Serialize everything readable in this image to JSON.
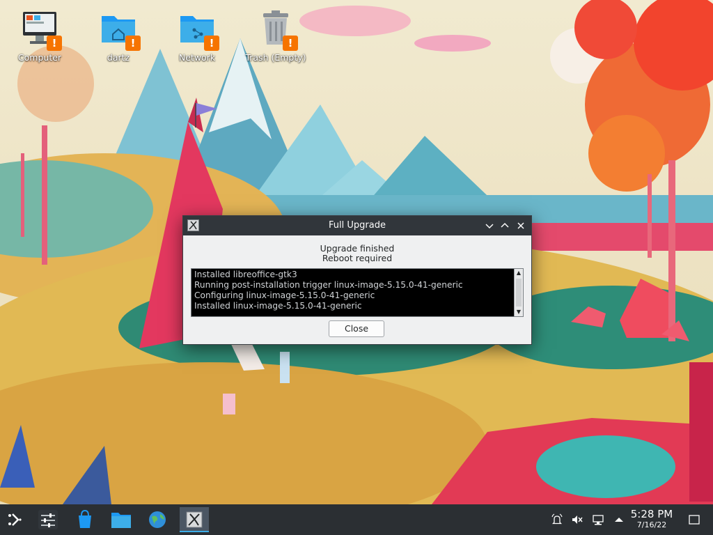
{
  "desktop": {
    "icons": [
      {
        "label": "Computer",
        "icon": "computer-icon"
      },
      {
        "label": "dartz",
        "icon": "home-folder-icon"
      },
      {
        "label": "Network",
        "icon": "network-folder-icon"
      },
      {
        "label": "Trash (Empty)",
        "icon": "trash-icon"
      }
    ],
    "badge": "!"
  },
  "dialog": {
    "title": "Full Upgrade",
    "status": "Upgrade finished",
    "substatus": "Reboot required",
    "log": [
      "Installed libreoffice-gtk3",
      "Running post-installation trigger linux-image-5.15.0-41-generic",
      "Configuring linux-image-5.15.0-41-generic",
      "Installed linux-image-5.15.0-41-generic"
    ],
    "close_label": "Close"
  },
  "taskbar": {
    "launchers": [
      "application-launcher-icon",
      "settings-icon",
      "discover-store-icon",
      "file-manager-icon",
      "web-browser-icon",
      "upgrade-tool-icon"
    ],
    "tray": [
      "notifications-icon",
      "volume-muted-icon",
      "network-icon",
      "tray-expand-icon"
    ],
    "clock": {
      "time": "5:28 PM",
      "date": "7/16/22"
    }
  },
  "colors": {
    "accent": "#3daee9",
    "warning": "#f67400",
    "titlebar": "#31363b",
    "panel": "#2b2f33"
  }
}
